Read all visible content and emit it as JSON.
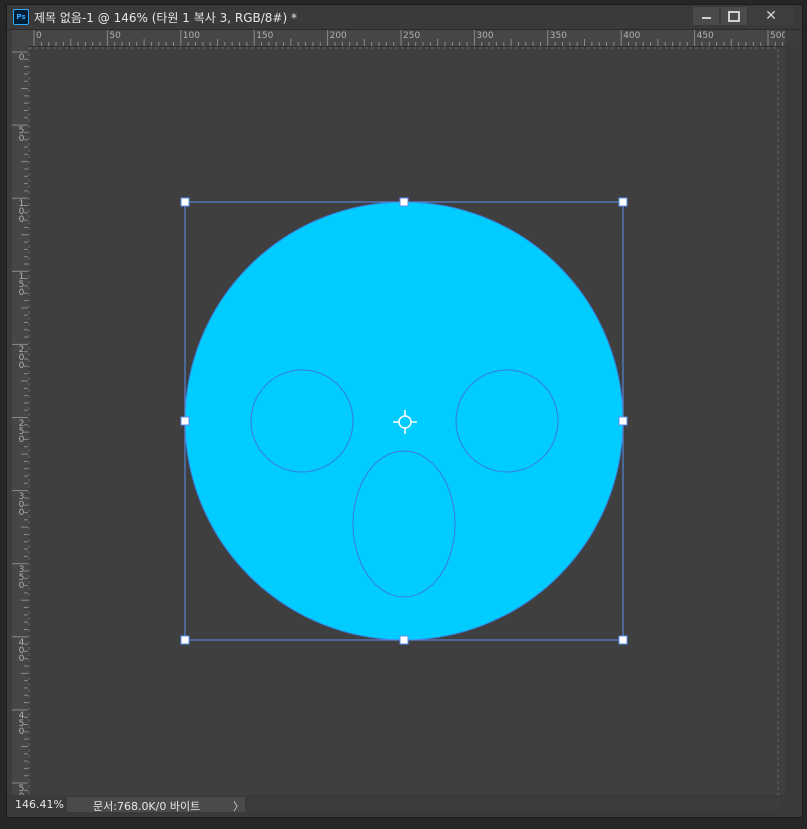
{
  "window": {
    "app_badge": "Ps",
    "title": "제목 없음-1 @ 146% (타원 1 복사 3, RGB/8#) *"
  },
  "window_controls": {
    "close_glyph": "✕"
  },
  "rulers": {
    "horizontal": [
      "0",
      "50",
      "100",
      "150",
      "200",
      "250",
      "300",
      "350",
      "400",
      "450",
      "500"
    ],
    "vertical": [
      "0",
      "5\n0",
      "1\n0\n0",
      "1\n5\n0",
      "2\n0\n0",
      "2\n5\n0",
      "3\n0\n0",
      "3\n5\n0",
      "4\n0\n0",
      "4\n5\n0",
      "5\n0"
    ]
  },
  "canvas": {
    "fill_color": "#00ccff",
    "outline_color": "#3a7bd8",
    "transform_box_color": "#5b8ff0",
    "shapes": [
      "face-circle",
      "left-eye-ellipse",
      "right-eye-ellipse",
      "mouth-ellipse"
    ]
  },
  "status": {
    "zoom": "146.41%",
    "doc_info": "문서:768.0K/0 바이트",
    "arrow": "〉"
  },
  "icons": [
    "photoshop-icon",
    "minimize-icon",
    "maximize-icon",
    "close-icon",
    "reference-point-icon"
  ]
}
